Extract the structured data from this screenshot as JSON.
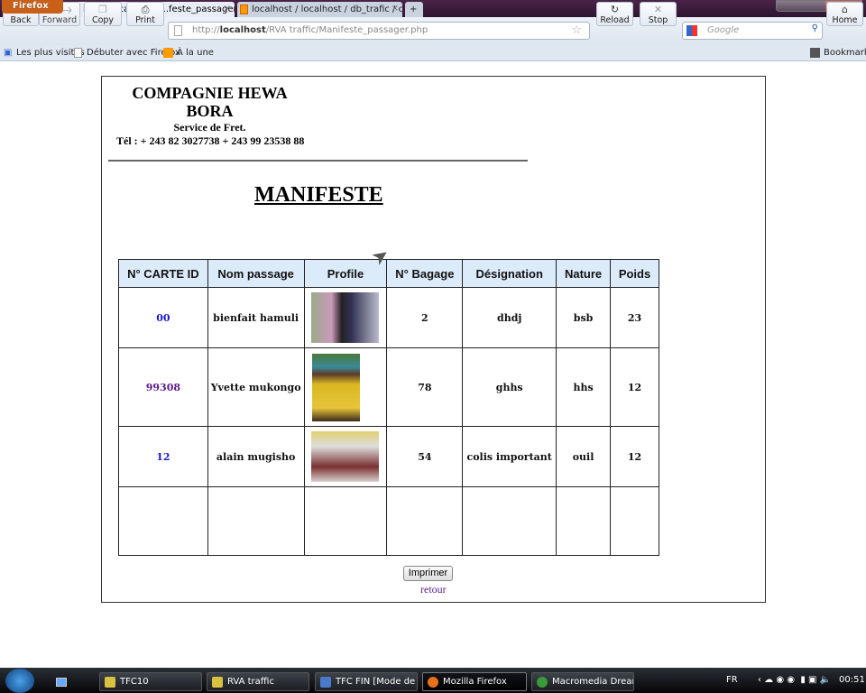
{
  "browser": {
    "menu_button": "Firefox",
    "tabs": [
      {
        "label": "http://localhost/R...feste_passager.php",
        "active": true
      },
      {
        "label": "localhost / localhost / db_trafic / co...",
        "active": false
      }
    ],
    "new_tab": "+",
    "nav": {
      "back": "Back",
      "forward": "Forward",
      "copy": "Copy",
      "print": "Print",
      "reload": "Reload",
      "stop": "Stop",
      "home": "Home"
    },
    "url_prefix": "http://",
    "url_host": "localhost",
    "url_path": "/RVA traffic/Manifeste_passager.php",
    "search_placeholder": "Google",
    "bookmarks": [
      "Les plus visités",
      "Débuter avec Firefox",
      "À la une"
    ],
    "bookmarks_menu": "Bookmarks"
  },
  "page": {
    "company_line1": "COMPAGNIE HEWA",
    "company_line2": "BORA",
    "service": "Service de Fret.",
    "phone": "Tél : + 243 82 3027738 + 243 99 23538 88",
    "title": "MANIFESTE",
    "table": {
      "headers": [
        "N° CARTE ID",
        "Nom passage",
        "Profile",
        "N° Bagage",
        "Désignation",
        "Nature",
        "Poids"
      ],
      "rows": [
        {
          "id": "00",
          "nom": "bienfait hamuli",
          "bagage": "2",
          "designation": "dhdj",
          "nature": "bsb",
          "poids": "23"
        },
        {
          "id": "99308",
          "nom": "Yvette mukongo",
          "bagage": "78",
          "designation": "ghhs",
          "nature": "hhs",
          "poids": "12"
        },
        {
          "id": "12",
          "nom": "alain mugisho",
          "bagage": "54",
          "designation": "colis important",
          "nature": "ouil",
          "poids": "12"
        }
      ]
    },
    "print_button": "Imprimer",
    "back_link": "retour"
  },
  "taskbar": {
    "items": [
      "TFC10",
      "RVA traffic",
      "TFC FIN [Mode de c...",
      "Mozilla Firefox",
      "Macromedia Dream..."
    ],
    "lang": "FR",
    "clock": "00:51"
  }
}
